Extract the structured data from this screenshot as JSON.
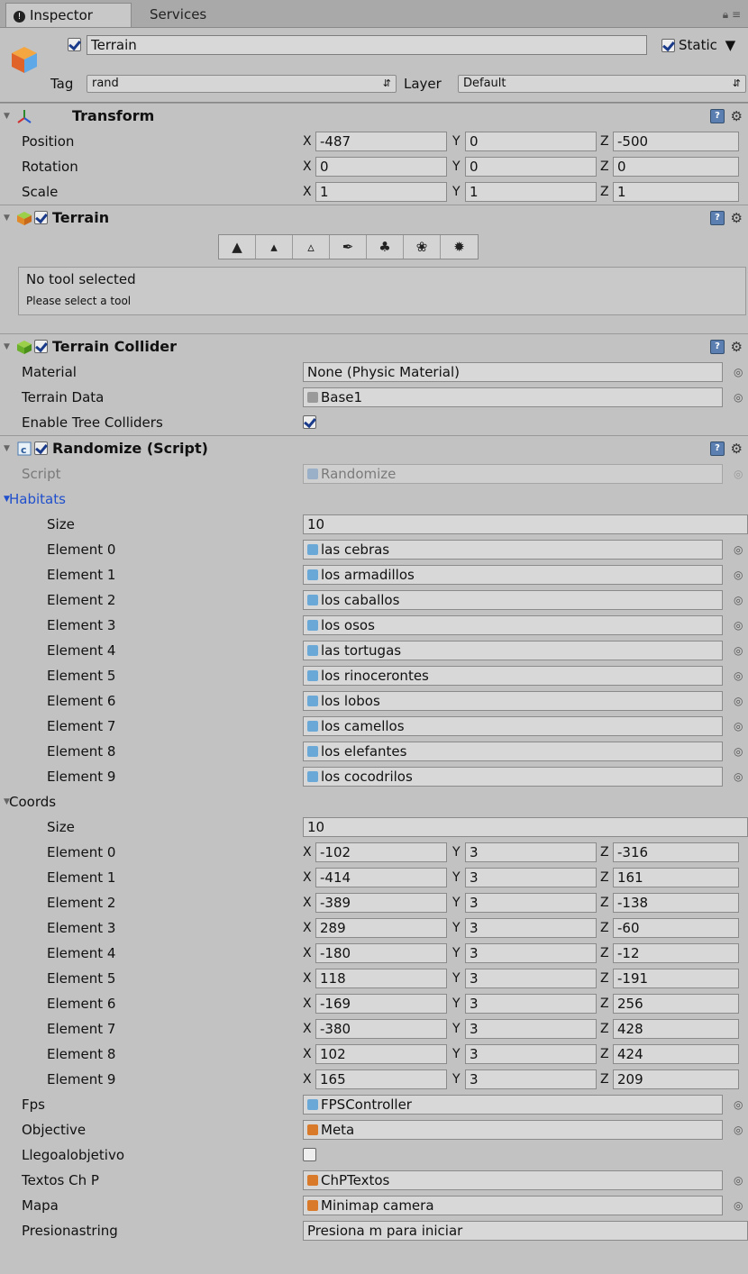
{
  "tabs": [
    {
      "label": "Inspector"
    },
    {
      "label": "Services"
    }
  ],
  "header": {
    "name": "Terrain",
    "static_label": "Static",
    "tag_label": "Tag",
    "tag_value": "rand",
    "layer_label": "Layer",
    "layer_value": "Default"
  },
  "transform": {
    "title": "Transform",
    "rows": [
      {
        "label": "Position",
        "x": "-487",
        "y": "0",
        "z": "-500"
      },
      {
        "label": "Rotation",
        "x": "0",
        "y": "0",
        "z": "0"
      },
      {
        "label": "Scale",
        "x": "1",
        "y": "1",
        "z": "1"
      }
    ]
  },
  "terrain": {
    "title": "Terrain",
    "info_title": "No tool selected",
    "info_sub": "Please select a tool"
  },
  "collider": {
    "title": "Terrain Collider",
    "material_label": "Material",
    "material_value": "None (Physic Material)",
    "data_label": "Terrain Data",
    "data_value": "Base1",
    "trees_label": "Enable Tree Colliders"
  },
  "script": {
    "title": "Randomize (Script)",
    "script_label": "Script",
    "script_value": "Randomize",
    "habitats_label": "Habitats",
    "size_label": "Size",
    "habitats_size": "10",
    "habitats": [
      {
        "label": "Element 0",
        "value": "las cebras"
      },
      {
        "label": "Element 1",
        "value": "los armadillos"
      },
      {
        "label": "Element 2",
        "value": "los caballos"
      },
      {
        "label": "Element 3",
        "value": "los osos"
      },
      {
        "label": "Element 4",
        "value": "las tortugas"
      },
      {
        "label": "Element 5",
        "value": "los rinocerontes"
      },
      {
        "label": "Element 6",
        "value": "los lobos"
      },
      {
        "label": "Element 7",
        "value": "los camellos"
      },
      {
        "label": "Element 8",
        "value": "los elefantes"
      },
      {
        "label": "Element 9",
        "value": "los cocodrilos"
      }
    ],
    "coords_label": "Coords",
    "coords_size": "10",
    "coords": [
      {
        "label": "Element 0",
        "x": "-102",
        "y": "3",
        "z": "-316"
      },
      {
        "label": "Element 1",
        "x": "-414",
        "y": "3",
        "z": "161"
      },
      {
        "label": "Element 2",
        "x": "-389",
        "y": "3",
        "z": "-138"
      },
      {
        "label": "Element 3",
        "x": "289",
        "y": "3",
        "z": "-60"
      },
      {
        "label": "Element 4",
        "x": "-180",
        "y": "3",
        "z": "-12"
      },
      {
        "label": "Element 5",
        "x": "118",
        "y": "3",
        "z": "-191"
      },
      {
        "label": "Element 6",
        "x": "-169",
        "y": "3",
        "z": "256"
      },
      {
        "label": "Element 7",
        "x": "-380",
        "y": "3",
        "z": "428"
      },
      {
        "label": "Element 8",
        "x": "102",
        "y": "3",
        "z": "424"
      },
      {
        "label": "Element 9",
        "x": "165",
        "y": "3",
        "z": "209"
      }
    ],
    "fps_label": "Fps",
    "fps_value": "FPSController",
    "objective_label": "Objective",
    "objective_value": "Meta",
    "llego_label": "Llegoalobjetivo",
    "textos_label": "Textos Ch P",
    "textos_value": "ChPTextos",
    "mapa_label": "Mapa",
    "mapa_value": "Minimap camera",
    "presiona_label": "Presionastring",
    "presiona_value": "Presiona m para iniciar"
  },
  "axes": {
    "x": "X",
    "y": "Y",
    "z": "Z"
  },
  "icons": [
    "info-icon",
    "lock-icon",
    "menu-icon",
    "gameobject-icon",
    "transform-icon",
    "terrain-icon",
    "script-icon",
    "help-icon",
    "gear-icon",
    "object-picker-icon",
    "fold-arrow-icon"
  ]
}
